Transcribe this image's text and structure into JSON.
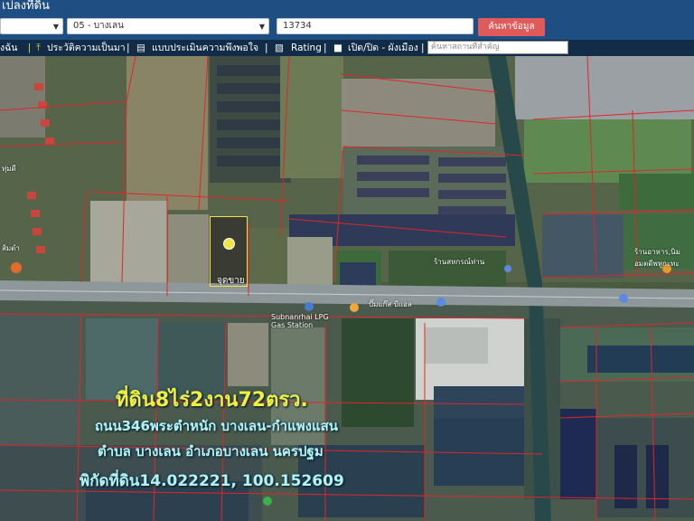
{
  "header": {
    "title": "เปลงที่ดิน",
    "province_select": "",
    "district_select": "05 - บางเลน",
    "parcel_input": "13734",
    "search_button": "ค้นหาข้อมูล"
  },
  "toolbar": {
    "item1": "งฉัน",
    "item2": "ประวัติความเป็นมา",
    "item3": "แบบประเมินความพึงพอใจ",
    "item4": "Rating",
    "item5": "เปิด/ปิด - ผังเมือง",
    "search_placeholder": "ค้นหาสถานที่สำคัญ"
  },
  "map": {
    "plot_label": "จุดขาย",
    "labels": {
      "shop1": "ร้านสหกรณ์ท่าน",
      "shop2": "ร้านอาหาร,นิม อมตดีพหูกะทะ",
      "road_place1": "ปั๊มแก๊ส บีแอล",
      "station": "Subnanrhai LPG Gas Station",
      "left_label": "ทุ่มดี",
      "left_label2": "ส้มตำ"
    },
    "overlay": {
      "line1": "ที่ดิน8ไร่2งาน72ตรว.",
      "line2": "ถนน346พระตำหนัก บางเลน-กำแพงแสน",
      "line3": "ตำบล บางเลน อำเภอบางเลน นครปฐม",
      "line4": "พิกัดที่ดิน14.022221, 100.152609"
    },
    "colors": {
      "header": "#1f4f82",
      "toolbar": "#122b46",
      "button": "#e05a5a",
      "parcel_lines": "#e0262a",
      "highlight": "#f2e34a",
      "overlay_yellow": "#f5ee3a",
      "overlay_teal": "#b8f2f0"
    }
  }
}
